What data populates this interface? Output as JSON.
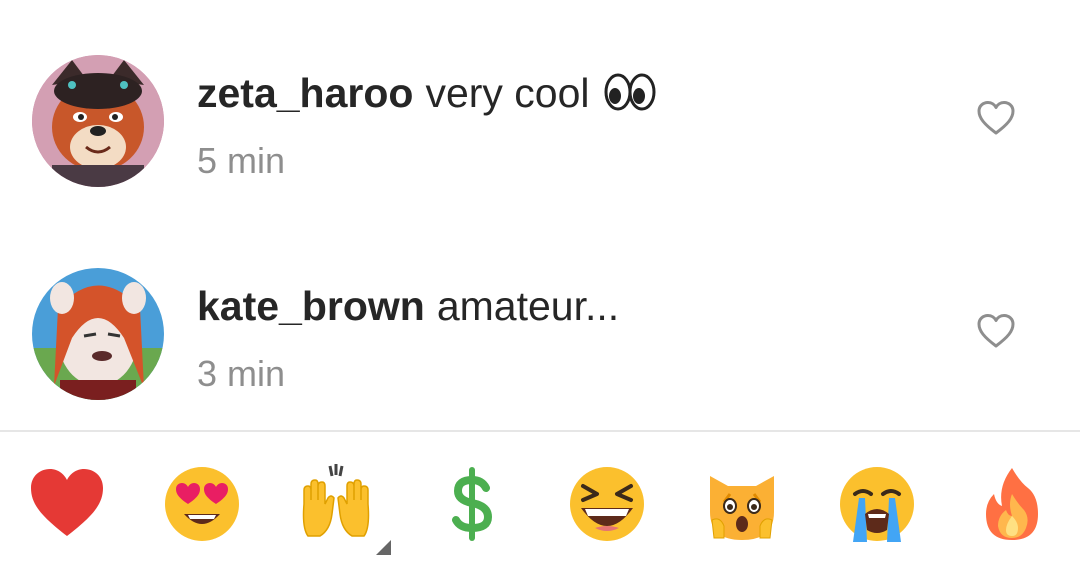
{
  "comments": [
    {
      "username": "zeta_haroo",
      "text": "very cool",
      "inline_emoji": "eyes-emoji",
      "time": "5 min",
      "like_icon": "heart-outline-icon"
    },
    {
      "username": "kate_brown",
      "text": "amateur...",
      "time": "3 min",
      "like_icon": "heart-outline-icon"
    }
  ],
  "reactions": [
    {
      "name": "red-heart-emoji"
    },
    {
      "name": "heart-eyes-emoji"
    },
    {
      "name": "raising-hands-emoji"
    },
    {
      "name": "dollar-sign-emoji"
    },
    {
      "name": "grinning-squinting-emoji"
    },
    {
      "name": "weary-cat-emoji"
    },
    {
      "name": "loudly-crying-emoji"
    },
    {
      "name": "fire-emoji"
    }
  ],
  "colors": {
    "username": "#262626",
    "meta_text": "#8e8e8e",
    "divider": "#e6e6e6",
    "emoji_yellow": "#fbc02d",
    "heart_red": "#e53935",
    "dollar_green": "#4caf50"
  }
}
